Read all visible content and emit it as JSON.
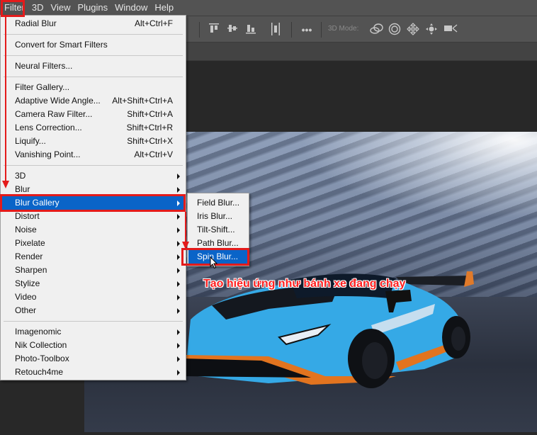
{
  "menubar": {
    "items": [
      {
        "label": "Filter",
        "active": true
      },
      {
        "label": "3D"
      },
      {
        "label": "View"
      },
      {
        "label": "Plugins"
      },
      {
        "label": "Window"
      },
      {
        "label": "Help"
      }
    ]
  },
  "options_bar": {
    "mode_label": "3D Mode:",
    "icons": [
      "align-top-edges-icon",
      "align-vertical-centers-icon",
      "align-bottom-edges-icon",
      "distribute-horizontal-icon",
      "more-options-icon",
      "orbit-3d-icon",
      "roll-3d-icon",
      "pan-3d-icon",
      "slide-3d-icon",
      "scale-3d-icon"
    ]
  },
  "filter_menu": {
    "groups": [
      [
        {
          "label": "Radial Blur",
          "shortcut": "Alt+Ctrl+F"
        }
      ],
      [
        {
          "label": "Convert for Smart Filters"
        }
      ],
      [
        {
          "label": "Neural Filters..."
        }
      ],
      [
        {
          "label": "Filter Gallery..."
        },
        {
          "label": "Adaptive Wide Angle...",
          "shortcut": "Alt+Shift+Ctrl+A"
        },
        {
          "label": "Camera Raw Filter...",
          "shortcut": "Shift+Ctrl+A"
        },
        {
          "label": "Lens Correction...",
          "shortcut": "Shift+Ctrl+R"
        },
        {
          "label": "Liquify...",
          "shortcut": "Shift+Ctrl+X"
        },
        {
          "label": "Vanishing Point...",
          "shortcut": "Alt+Ctrl+V"
        }
      ],
      [
        {
          "label": "3D",
          "submenu": true
        },
        {
          "label": "Blur",
          "submenu": true
        },
        {
          "label": "Blur Gallery",
          "submenu": true,
          "highlighted": true
        },
        {
          "label": "Distort",
          "submenu": true
        },
        {
          "label": "Noise",
          "submenu": true
        },
        {
          "label": "Pixelate",
          "submenu": true
        },
        {
          "label": "Render",
          "submenu": true
        },
        {
          "label": "Sharpen",
          "submenu": true
        },
        {
          "label": "Stylize",
          "submenu": true
        },
        {
          "label": "Video",
          "submenu": true
        },
        {
          "label": "Other",
          "submenu": true
        }
      ],
      [
        {
          "label": "Imagenomic",
          "submenu": true
        },
        {
          "label": "Nik Collection",
          "submenu": true
        },
        {
          "label": "Photo-Toolbox",
          "submenu": true
        },
        {
          "label": "Retouch4me",
          "submenu": true
        }
      ]
    ]
  },
  "blur_gallery_submenu": {
    "items": [
      {
        "label": "Field Blur..."
      },
      {
        "label": "Iris Blur..."
      },
      {
        "label": "Tilt-Shift..."
      },
      {
        "label": "Path Blur..."
      },
      {
        "label": "Spin Blur...",
        "highlighted": true
      }
    ]
  },
  "annotation": {
    "caption": "Tạo hiệu ứng như bánh xe đang chạy",
    "color": "#e41b1b"
  },
  "colors": {
    "menu_highlight": "#0a64c8",
    "menu_bg": "#f0f0f0",
    "app_chrome": "#535353"
  }
}
